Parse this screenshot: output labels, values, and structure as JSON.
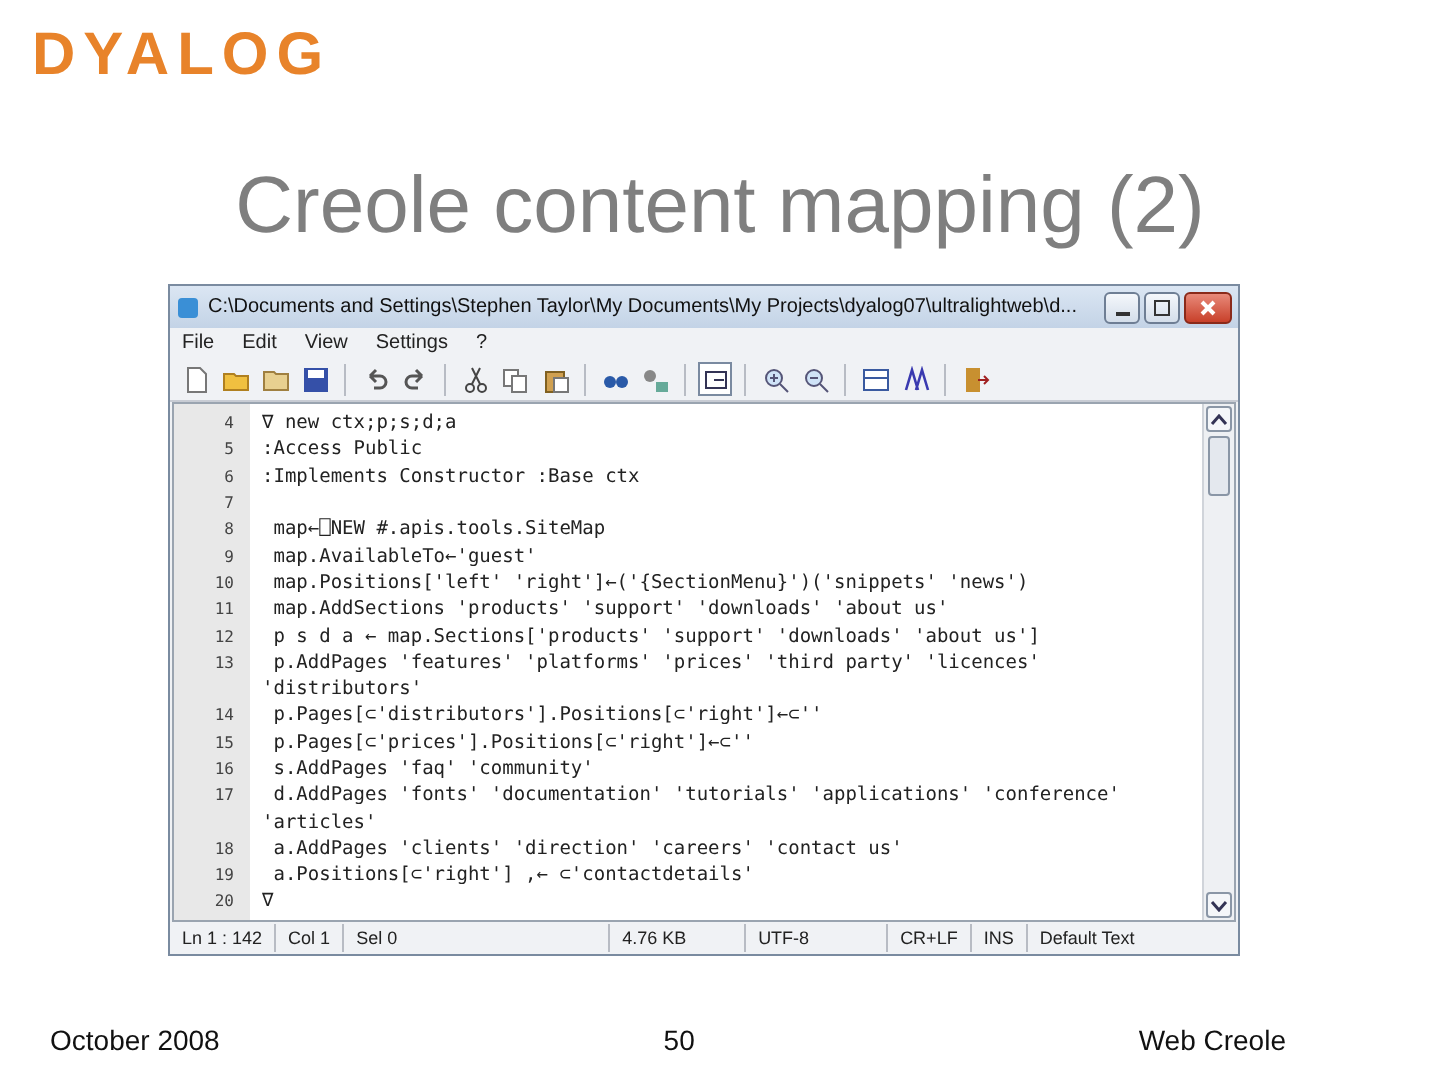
{
  "logo": "DYALOG",
  "slide_title": "Creole content mapping (2)",
  "window": {
    "title": "C:\\Documents and Settings\\Stephen Taylor\\My Documents\\My Projects\\dyalog07\\ultralightweb\\d...",
    "menu": [
      "File",
      "Edit",
      "View",
      "Settings",
      "?"
    ],
    "editor": {
      "lines": [
        {
          "number": "4",
          "text": "∇ new ctx;p;s;d;a"
        },
        {
          "number": "5",
          "text": ":Access Public"
        },
        {
          "number": "6",
          "text": ":Implements Constructor :Base ctx"
        },
        {
          "number": "7"
        },
        {
          "number": "8",
          "text": " map←⎕NEW #.apis.tools.SiteMap"
        },
        {
          "number": "9",
          "text": " map.AvailableTo←'guest'"
        },
        {
          "number": "10",
          "text": " map.Positions['left' 'right']←('{SectionMenu}')('snippets' 'news')"
        },
        {
          "number": "11",
          "text": " map.AddSections 'products' 'support' 'downloads' 'about us'"
        },
        {
          "number": "12",
          "text": " p s d a ← map.Sections['products' 'support' 'downloads' 'about us']"
        },
        {
          "number": "13",
          "text": " p.AddPages 'features' 'platforms' 'prices' 'third party' 'licences'",
          "continuation": "'distributors'"
        },
        {
          "number": "14",
          "text": " p.Pages[⊂'distributors'].Positions[⊂'right']←⊂''"
        },
        {
          "number": "15",
          "text": " p.Pages[⊂'prices'].Positions[⊂'right']←⊂''"
        },
        {
          "number": "16",
          "text": " s.AddPages 'faq' 'community'"
        },
        {
          "number": "17",
          "text": " d.AddPages 'fonts' 'documentation' 'tutorials' 'applications' 'conference'",
          "continuation": "'articles'"
        },
        {
          "number": "18",
          "text": " a.AddPages 'clients' 'direction' 'careers' 'contact us'"
        },
        {
          "number": "19",
          "text": " a.Positions[⊂'right'] ,← ⊂'contactdetails'"
        },
        {
          "number": "20",
          "text": "∇"
        }
      ]
    },
    "status_bar": [
      "Ln 1 : 142",
      "Col 1",
      "Sel 0",
      "4.76 KB",
      "UTF-8",
      "CR+LF",
      "INS",
      "Default Text"
    ]
  },
  "footer": {
    "date": "October 2008",
    "page": "50",
    "topic": "Web Creole"
  }
}
